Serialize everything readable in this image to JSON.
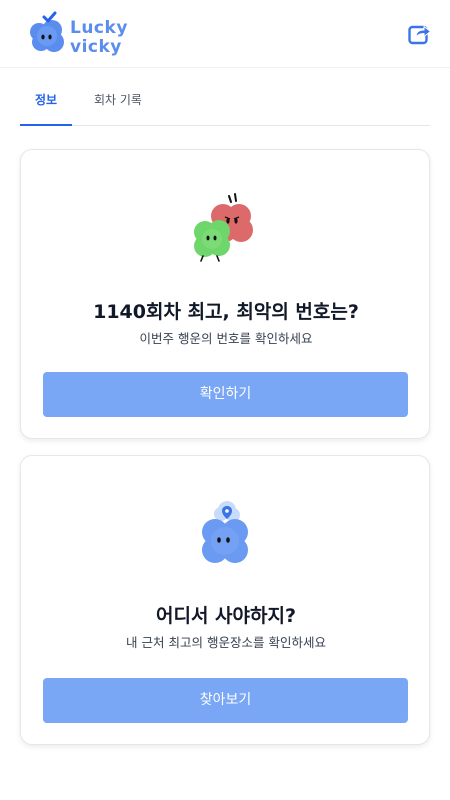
{
  "header": {
    "logo_line1": "Lucky",
    "logo_line2": "vicky",
    "share_icon": "share-icon"
  },
  "tabs": [
    {
      "label": "정보",
      "active": true
    },
    {
      "label": "회차 기록",
      "active": false
    }
  ],
  "cards": [
    {
      "title": "1140회차 최고, 최악의 번호는?",
      "subtitle": "이번주 행운의 번호를 확인하세요",
      "button_label": "확인하기",
      "illustration": "red-green-clover-characters"
    },
    {
      "title": "어디서 사야하지?",
      "subtitle": "내 근처 최고의 행운장소를 확인하세요",
      "button_label": "찾아보기",
      "illustration": "blue-clover-location-character"
    }
  ],
  "colors": {
    "brand": "#5b8def",
    "button": "#79a6f5",
    "active_tab": "#2563eb"
  }
}
